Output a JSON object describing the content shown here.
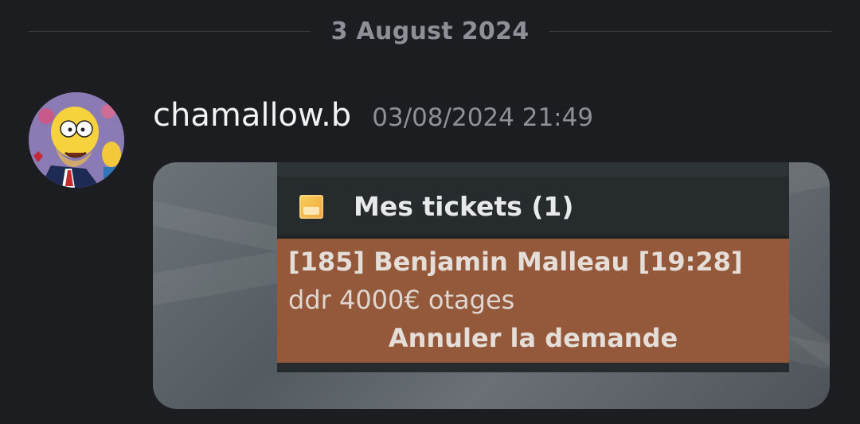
{
  "divider": {
    "date": "3 August 2024"
  },
  "message": {
    "username": "chamallow.b",
    "timestamp": "03/08/2024 21:49",
    "avatar_icon": "homer-avatar-icon"
  },
  "attachment": {
    "panel_title": "Mes tickets (1)",
    "panel_icon": "ticket-folder-icon",
    "ticket": {
      "title": "[185] Benjamin Malleau [19:28]",
      "body": "ddr 4000€ otages",
      "cancel_label": "Annuler la demande"
    }
  },
  "colors": {
    "background": "#1c1d21",
    "ticket_row": "#94583a",
    "panel": "#262b2e"
  }
}
